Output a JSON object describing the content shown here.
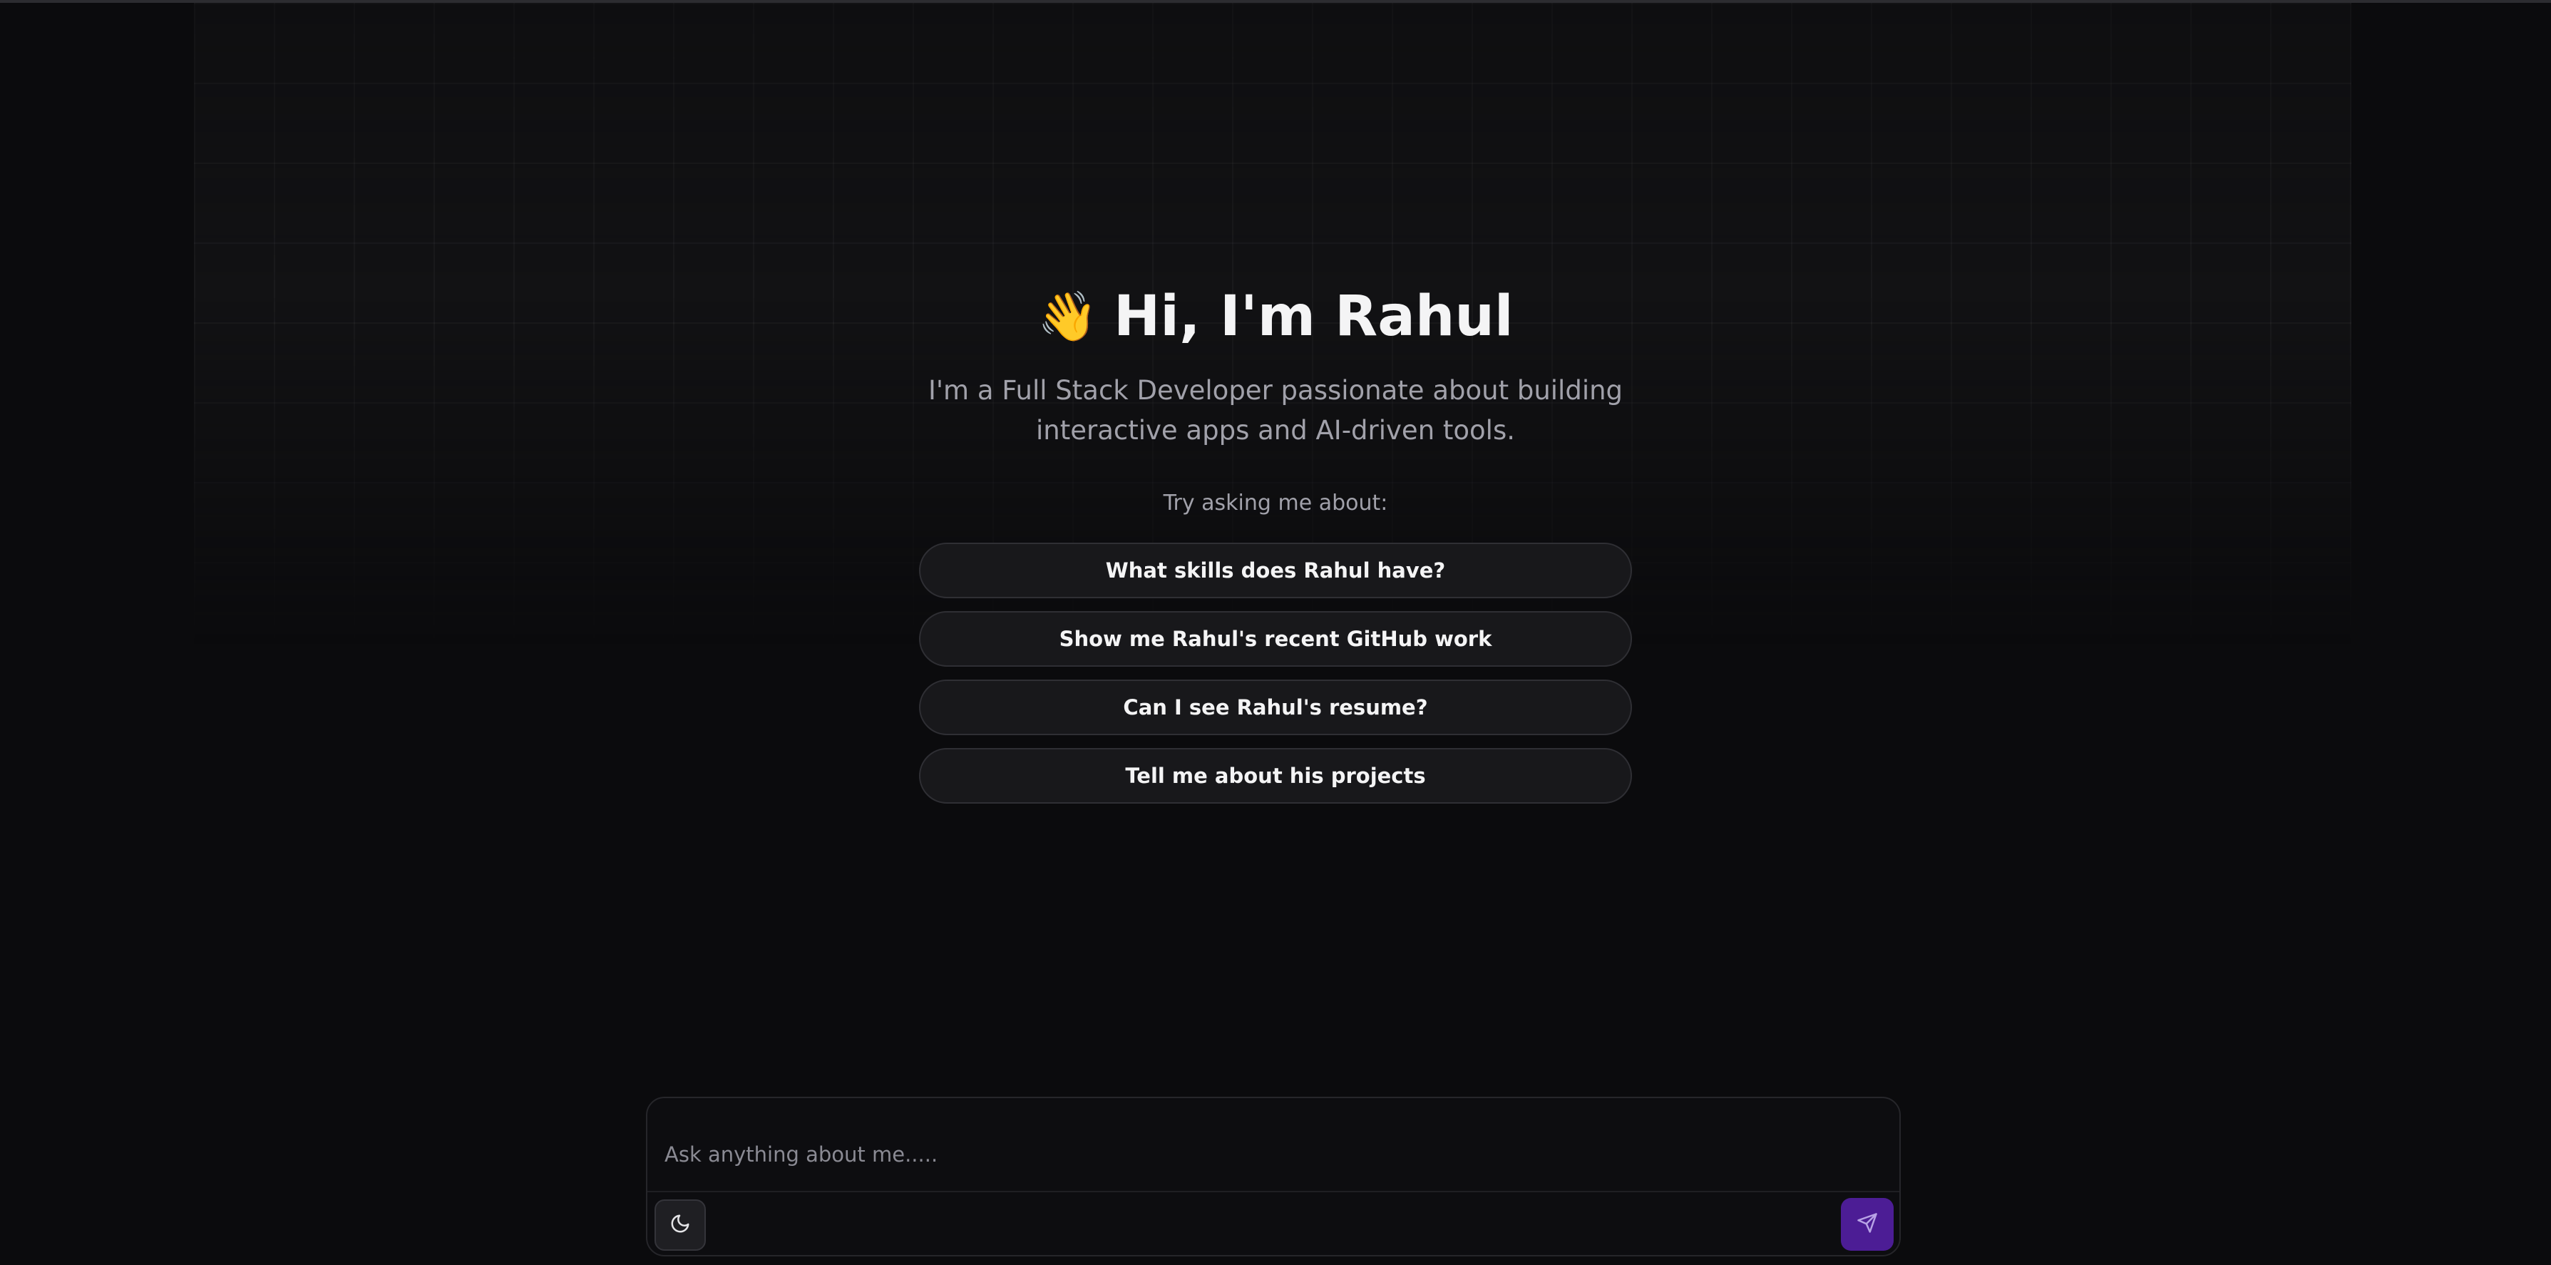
{
  "hero": {
    "wave_emoji": "👋",
    "title": "Hi, I'm Rahul",
    "subtitle": "I'm a Full Stack Developer passionate about building interactive apps and AI-driven tools.",
    "try_label": "Try asking me about:"
  },
  "suggestions": [
    {
      "label": "What skills does Rahul have?"
    },
    {
      "label": "Show me Rahul's recent GitHub work"
    },
    {
      "label": "Can I see Rahul's resume?"
    },
    {
      "label": "Tell me about his projects"
    }
  ],
  "composer": {
    "placeholder": "Ask anything about me.....",
    "value": "",
    "theme_toggle_icon": "moon-icon",
    "send_icon": "send-icon"
  },
  "colors": {
    "background": "#0b0b0d",
    "accent": "#4c1d95",
    "text_primary": "#f4f4f5",
    "text_secondary": "#a1a1aa"
  }
}
